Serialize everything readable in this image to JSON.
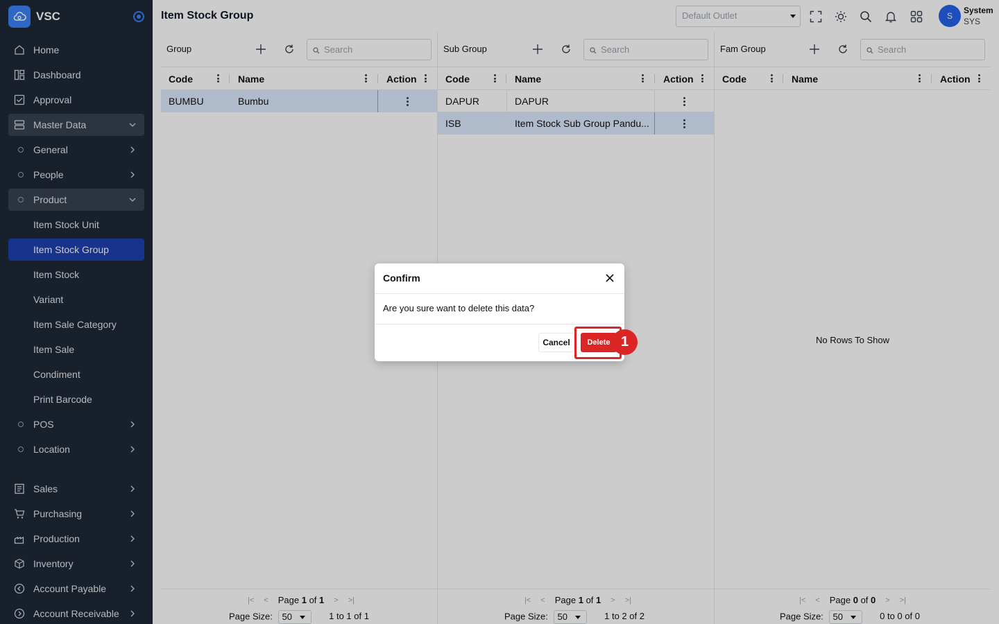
{
  "app": {
    "name": "VSC"
  },
  "sidebar": {
    "items": [
      {
        "label": "Home"
      },
      {
        "label": "Dashboard"
      },
      {
        "label": "Approval"
      },
      {
        "label": "Master Data"
      },
      {
        "label": "General"
      },
      {
        "label": "People"
      },
      {
        "label": "Product"
      },
      {
        "label": "Item Stock Unit"
      },
      {
        "label": "Item Stock Group"
      },
      {
        "label": "Item Stock"
      },
      {
        "label": "Variant"
      },
      {
        "label": "Item Sale Category"
      },
      {
        "label": "Item Sale"
      },
      {
        "label": "Condiment"
      },
      {
        "label": "Print Barcode"
      },
      {
        "label": "POS"
      },
      {
        "label": "Location"
      },
      {
        "label": "Sales"
      },
      {
        "label": "Purchasing"
      },
      {
        "label": "Production"
      },
      {
        "label": "Inventory"
      },
      {
        "label": "Account Payable"
      },
      {
        "label": "Account Receivable"
      }
    ]
  },
  "header": {
    "title": "Item Stock Group",
    "outlet_placeholder": "Default Outlet",
    "user": {
      "initial": "S",
      "name": "System",
      "code": "SYS"
    }
  },
  "panels": {
    "group": {
      "title": "Group",
      "search_placeholder": "Search",
      "columns": [
        "Code",
        "Name",
        "Action"
      ],
      "rows": [
        {
          "code": "BUMBU",
          "name": "Bumbu"
        }
      ],
      "pager": {
        "page_label": "Page",
        "page": "1",
        "of_label": "of",
        "total_pages": "1",
        "size_label": "Page Size:",
        "size": "50",
        "range": "1 to 1 of 1"
      }
    },
    "subgroup": {
      "title": "Sub Group",
      "search_placeholder": "Search",
      "columns": [
        "Code",
        "Name",
        "Action"
      ],
      "rows": [
        {
          "code": "DAPUR",
          "name": "DAPUR"
        },
        {
          "code": "ISB",
          "name": "Item Stock Sub Group Pandu..."
        }
      ],
      "pager": {
        "page_label": "Page",
        "page": "1",
        "of_label": "of",
        "total_pages": "1",
        "size_label": "Page Size:",
        "size": "50",
        "range": "1 to 2 of 2"
      }
    },
    "famgroup": {
      "title": "Fam Group",
      "search_placeholder": "Search",
      "columns": [
        "Code",
        "Name",
        "Action"
      ],
      "empty_text": "No Rows To Show",
      "pager": {
        "page_label": "Page",
        "page": "0",
        "of_label": "of",
        "total_pages": "0",
        "size_label": "Page Size:",
        "size": "50",
        "range": "0 to 0 of 0"
      }
    }
  },
  "dialog": {
    "title": "Confirm",
    "message": "Are you sure want to delete this data?",
    "cancel_label": "Cancel",
    "delete_label": "Delete"
  },
  "annotation": {
    "step": "1"
  },
  "colors": {
    "sidebar_bg": "#1f2937",
    "active": "#1e40af",
    "accent": "#3b82f6",
    "danger": "#dc2626",
    "selected_row": "#dbeafe"
  }
}
